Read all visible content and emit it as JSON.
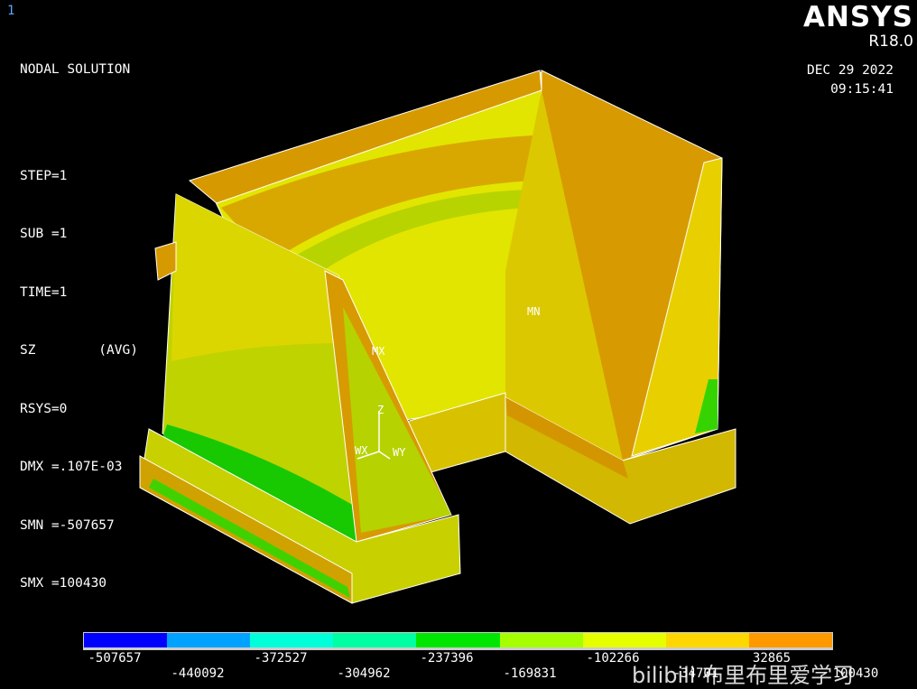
{
  "window": {
    "number": "1"
  },
  "info": {
    "title": "NODAL SOLUTION",
    "lines": [
      "STEP=1",
      "SUB =1",
      "TIME=1",
      "SZ        (AVG)",
      "RSYS=0",
      "DMX =.107E-03",
      "SMN =-507657",
      "SMX =100430"
    ]
  },
  "brand": {
    "name": "ANSYS",
    "version": "R18.0"
  },
  "datetime": {
    "date": "DEC 29 2022",
    "time": "09:15:41"
  },
  "markers": {
    "mx": "MX",
    "mn": "MN"
  },
  "triad": {
    "z": "Z",
    "x": "WX",
    "y": "WY"
  },
  "legend": {
    "colors": [
      "#0000ff",
      "#00a2ff",
      "#00ffd9",
      "#00ffa2",
      "#00e600",
      "#a6ff00",
      "#e6ff00",
      "#ffd700",
      "#ff9900",
      "#ff0000"
    ],
    "labels": [
      "-507657",
      "-440092",
      "-372527",
      "-304962",
      "-237396",
      "-169831",
      "-102266",
      "-34701",
      "32865",
      "100430"
    ]
  },
  "watermark": {
    "text": "bilibili 布里布里爱学习"
  }
}
